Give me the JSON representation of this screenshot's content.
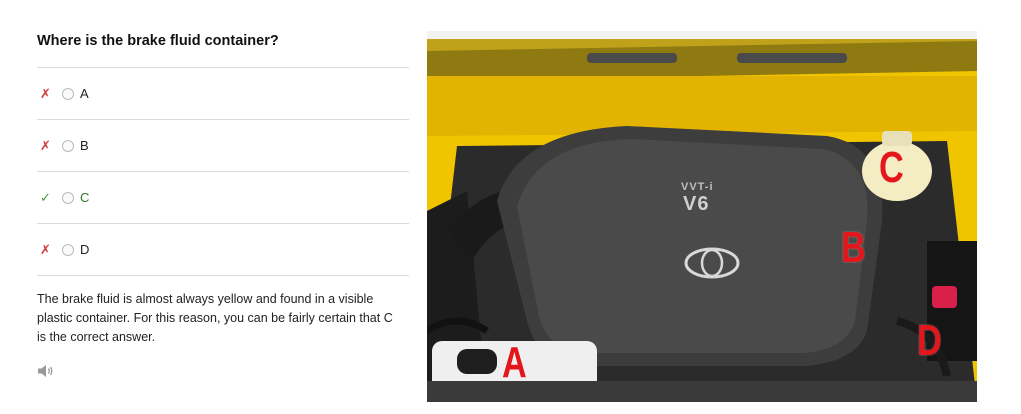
{
  "quiz": {
    "question": "Where is the brake fluid container?",
    "answers": [
      {
        "mark": "✗",
        "status": "wrong",
        "label": "A"
      },
      {
        "mark": "✗",
        "status": "wrong",
        "label": "B"
      },
      {
        "mark": "✓",
        "status": "correct",
        "label": "C"
      },
      {
        "mark": "✗",
        "status": "wrong",
        "label": "D"
      }
    ],
    "explanation": "The brake fluid is almost always yellow and found in a visible plastic container. For this reason, you can be fairly certain that C is the correct answer."
  },
  "image": {
    "labels": {
      "a": "A",
      "b": "B",
      "c": "C",
      "d": "D"
    },
    "cover_text": {
      "line1": "VVT-i",
      "line2": "V6"
    }
  },
  "colors": {
    "wrong": "#d23b3b",
    "correct": "#3a9a3a",
    "label_red": "#e3161b",
    "body_yellow": "#f1c400"
  },
  "icons": {
    "audio": "speaker-icon"
  }
}
